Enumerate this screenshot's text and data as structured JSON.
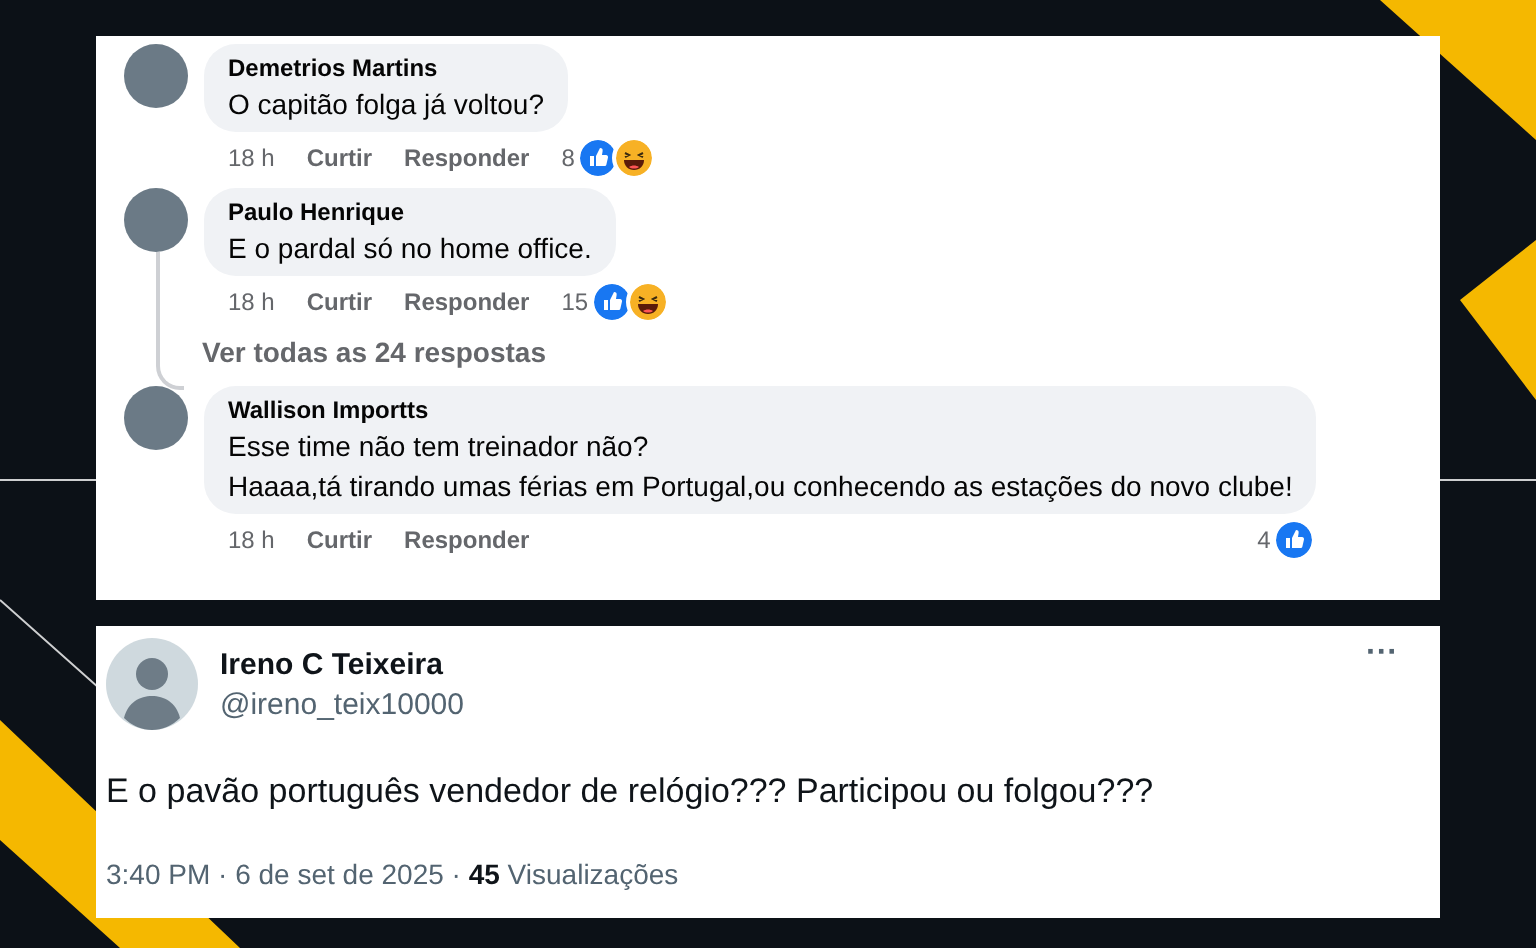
{
  "comments": [
    {
      "author": "Demetrios Martins",
      "text": [
        "O capitão folga já voltou?"
      ],
      "time": "18 h",
      "like": "Curtir",
      "reply": "Responder",
      "count": "8",
      "reactions": [
        {
          "kind": "like"
        },
        {
          "kind": "haha"
        }
      ],
      "thread": false
    },
    {
      "author": "Paulo Henrique",
      "text": [
        "E o pardal só no home office."
      ],
      "time": "18 h",
      "like": "Curtir",
      "reply": "Responder",
      "count": "15",
      "reactions": [
        {
          "kind": "like"
        },
        {
          "kind": "haha"
        }
      ],
      "thread": true,
      "more_replies": "Ver todas as 24 respostas"
    },
    {
      "author": "Wallison Importts",
      "text": [
        "Esse time não tem treinador não?",
        "Haaaa,tá tirando umas férias em Portugal,ou conhecendo as estações do novo clube!"
      ],
      "time": "18 h",
      "like": "Curtir",
      "reply": "Responder",
      "count": "4",
      "reactions": [
        {
          "kind": "like"
        }
      ],
      "thread": false
    }
  ],
  "tweet": {
    "name": "Ireno C Teixeira",
    "handle": "@ireno_teix10000",
    "more": "···",
    "text": "E o pavão português vendedor de relógio??? Participou ou folgou???",
    "footer": "3:40 PM · 6 de set de 2025 · **45** Visualizações"
  }
}
